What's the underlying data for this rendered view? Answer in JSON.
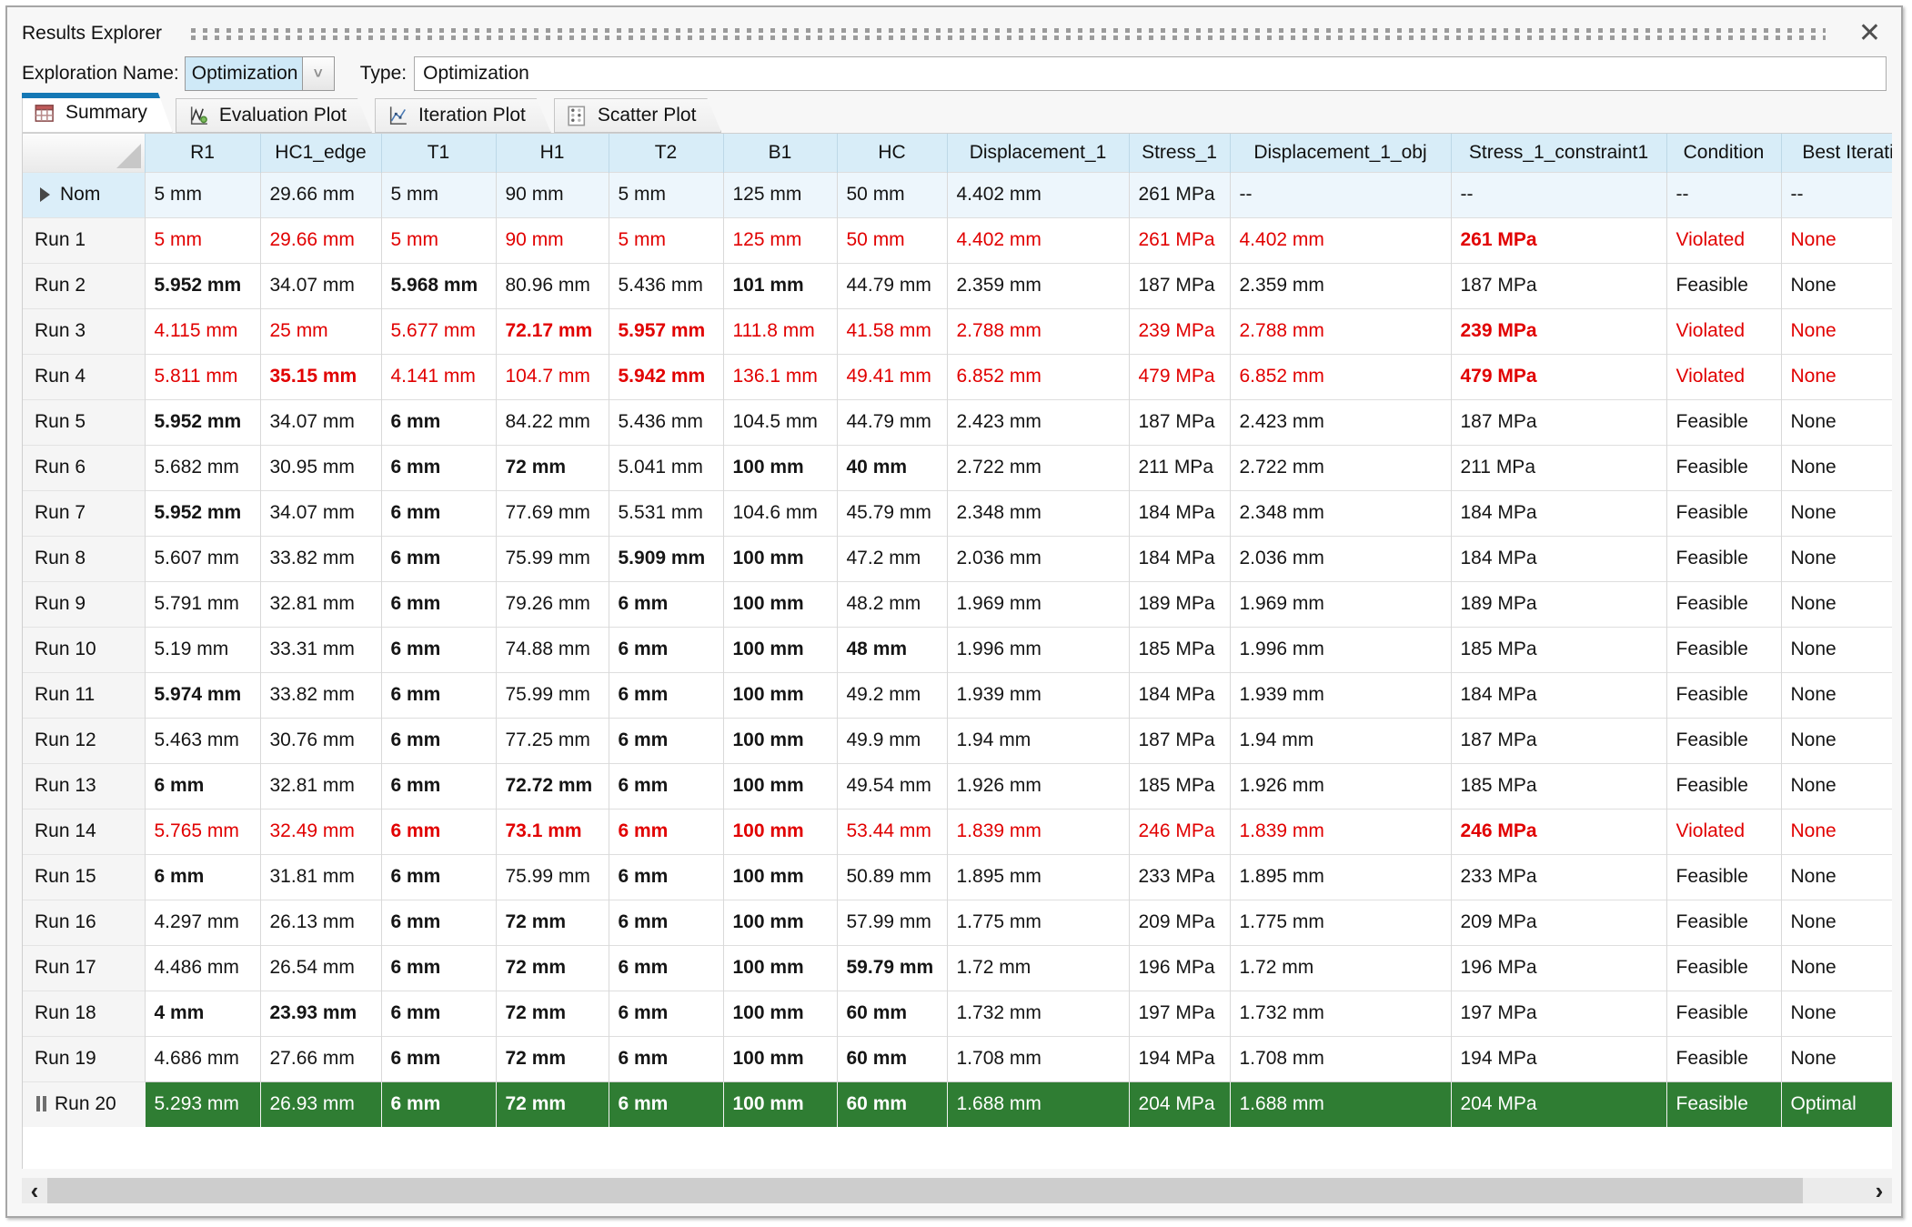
{
  "window": {
    "title": "Results Explorer"
  },
  "icons": {
    "close": "✕",
    "combo_chevron": "˅",
    "scroll_left": "‹",
    "scroll_right": "›"
  },
  "toolbar": {
    "exploration_label": "Exploration Name:",
    "exploration_value": "Optimization",
    "type_label": "Type:",
    "type_value": "Optimization"
  },
  "tabs": [
    {
      "label": "Summary",
      "icon": "summary-table-icon",
      "active": true
    },
    {
      "label": "Evaluation Plot",
      "icon": "evaluation-plot-icon",
      "active": false
    },
    {
      "label": "Iteration Plot",
      "icon": "iteration-plot-icon",
      "active": false
    },
    {
      "label": "Scatter Plot",
      "icon": "scatter-plot-icon",
      "active": false
    }
  ],
  "colors": {
    "active_tab_accent": "#1578b5",
    "header_bg": "#d8edf8",
    "nom_row_bg": "#edf6fc",
    "violated_text": "#e10000",
    "optimal_row_bg": "#2f7d33"
  },
  "table": {
    "columns": [
      "",
      "R1",
      "HC1_edge",
      "T1",
      "H1",
      "T2",
      "B1",
      "HC",
      "Displacement_1",
      "Stress_1",
      "Displacement_1_obj",
      "Stress_1_constraint1",
      "Condition",
      "Best Iteration"
    ],
    "rows": [
      {
        "label": "Nom",
        "icon": "play-icon",
        "state": "nom",
        "cells": [
          "5 mm",
          "29.66 mm",
          "5 mm",
          "90 mm",
          "5 mm",
          "125 mm",
          "50 mm",
          "4.402 mm",
          "261 MPa",
          "--",
          "--",
          "--",
          "--"
        ],
        "bold": []
      },
      {
        "label": "Run 1",
        "icon": null,
        "state": "violated",
        "cells": [
          "5 mm",
          "29.66 mm",
          "5 mm",
          "90 mm",
          "5 mm",
          "125 mm",
          "50 mm",
          "4.402 mm",
          "261 MPa",
          "4.402 mm",
          "261 MPa",
          "Violated",
          "None"
        ],
        "bold": [
          10
        ]
      },
      {
        "label": "Run 2",
        "icon": null,
        "state": "feasible",
        "cells": [
          "5.952 mm",
          "34.07 mm",
          "5.968 mm",
          "80.96 mm",
          "5.436 mm",
          "101 mm",
          "44.79 mm",
          "2.359 mm",
          "187 MPa",
          "2.359 mm",
          "187 MPa",
          "Feasible",
          "None"
        ],
        "bold": [
          0,
          2,
          5
        ]
      },
      {
        "label": "Run 3",
        "icon": null,
        "state": "violated",
        "cells": [
          "4.115 mm",
          "25 mm",
          "5.677 mm",
          "72.17 mm",
          "5.957 mm",
          "111.8 mm",
          "41.58 mm",
          "2.788 mm",
          "239 MPa",
          "2.788 mm",
          "239 MPa",
          "Violated",
          "None"
        ],
        "bold": [
          3,
          4,
          10
        ]
      },
      {
        "label": "Run 4",
        "icon": null,
        "state": "violated",
        "cells": [
          "5.811 mm",
          "35.15 mm",
          "4.141 mm",
          "104.7 mm",
          "5.942 mm",
          "136.1 mm",
          "49.41 mm",
          "6.852 mm",
          "479 MPa",
          "6.852 mm",
          "479 MPa",
          "Violated",
          "None"
        ],
        "bold": [
          1,
          4,
          10
        ]
      },
      {
        "label": "Run 5",
        "icon": null,
        "state": "feasible",
        "cells": [
          "5.952 mm",
          "34.07 mm",
          "6 mm",
          "84.22 mm",
          "5.436 mm",
          "104.5 mm",
          "44.79 mm",
          "2.423 mm",
          "187 MPa",
          "2.423 mm",
          "187 MPa",
          "Feasible",
          "None"
        ],
        "bold": [
          0,
          2
        ]
      },
      {
        "label": "Run 6",
        "icon": null,
        "state": "feasible",
        "cells": [
          "5.682 mm",
          "30.95 mm",
          "6 mm",
          "72 mm",
          "5.041 mm",
          "100 mm",
          "40 mm",
          "2.722 mm",
          "211 MPa",
          "2.722 mm",
          "211 MPa",
          "Feasible",
          "None"
        ],
        "bold": [
          2,
          3,
          5,
          6
        ]
      },
      {
        "label": "Run 7",
        "icon": null,
        "state": "feasible",
        "cells": [
          "5.952 mm",
          "34.07 mm",
          "6 mm",
          "77.69 mm",
          "5.531 mm",
          "104.6 mm",
          "45.79 mm",
          "2.348 mm",
          "184 MPa",
          "2.348 mm",
          "184 MPa",
          "Feasible",
          "None"
        ],
        "bold": [
          0,
          2
        ]
      },
      {
        "label": "Run 8",
        "icon": null,
        "state": "feasible",
        "cells": [
          "5.607 mm",
          "33.82 mm",
          "6 mm",
          "75.99 mm",
          "5.909 mm",
          "100 mm",
          "47.2 mm",
          "2.036 mm",
          "184 MPa",
          "2.036 mm",
          "184 MPa",
          "Feasible",
          "None"
        ],
        "bold": [
          2,
          4,
          5
        ]
      },
      {
        "label": "Run 9",
        "icon": null,
        "state": "feasible",
        "cells": [
          "5.791 mm",
          "32.81 mm",
          "6 mm",
          "79.26 mm",
          "6 mm",
          "100 mm",
          "48.2 mm",
          "1.969 mm",
          "189 MPa",
          "1.969 mm",
          "189 MPa",
          "Feasible",
          "None"
        ],
        "bold": [
          2,
          4,
          5
        ]
      },
      {
        "label": "Run 10",
        "icon": null,
        "state": "feasible",
        "cells": [
          "5.19 mm",
          "33.31 mm",
          "6 mm",
          "74.88 mm",
          "6 mm",
          "100 mm",
          "48 mm",
          "1.996 mm",
          "185 MPa",
          "1.996 mm",
          "185 MPa",
          "Feasible",
          "None"
        ],
        "bold": [
          2,
          4,
          5,
          6
        ]
      },
      {
        "label": "Run 11",
        "icon": null,
        "state": "feasible",
        "cells": [
          "5.974 mm",
          "33.82 mm",
          "6 mm",
          "75.99 mm",
          "6 mm",
          "100 mm",
          "49.2 mm",
          "1.939 mm",
          "184 MPa",
          "1.939 mm",
          "184 MPa",
          "Feasible",
          "None"
        ],
        "bold": [
          0,
          2,
          4,
          5
        ]
      },
      {
        "label": "Run 12",
        "icon": null,
        "state": "feasible",
        "cells": [
          "5.463 mm",
          "30.76 mm",
          "6 mm",
          "77.25 mm",
          "6 mm",
          "100 mm",
          "49.9 mm",
          "1.94 mm",
          "187 MPa",
          "1.94 mm",
          "187 MPa",
          "Feasible",
          "None"
        ],
        "bold": [
          2,
          4,
          5
        ]
      },
      {
        "label": "Run 13",
        "icon": null,
        "state": "feasible",
        "cells": [
          "6 mm",
          "32.81 mm",
          "6 mm",
          "72.72 mm",
          "6 mm",
          "100 mm",
          "49.54 mm",
          "1.926 mm",
          "185 MPa",
          "1.926 mm",
          "185 MPa",
          "Feasible",
          "None"
        ],
        "bold": [
          0,
          2,
          3,
          4,
          5
        ]
      },
      {
        "label": "Run 14",
        "icon": null,
        "state": "violated",
        "cells": [
          "5.765 mm",
          "32.49 mm",
          "6 mm",
          "73.1 mm",
          "6 mm",
          "100 mm",
          "53.44 mm",
          "1.839 mm",
          "246 MPa",
          "1.839 mm",
          "246 MPa",
          "Violated",
          "None"
        ],
        "bold": [
          2,
          3,
          4,
          5,
          10
        ]
      },
      {
        "label": "Run 15",
        "icon": null,
        "state": "feasible",
        "cells": [
          "6 mm",
          "31.81 mm",
          "6 mm",
          "75.99 mm",
          "6 mm",
          "100 mm",
          "50.89 mm",
          "1.895 mm",
          "233 MPa",
          "1.895 mm",
          "233 MPa",
          "Feasible",
          "None"
        ],
        "bold": [
          0,
          2,
          4,
          5
        ]
      },
      {
        "label": "Run 16",
        "icon": null,
        "state": "feasible",
        "cells": [
          "4.297 mm",
          "26.13 mm",
          "6 mm",
          "72 mm",
          "6 mm",
          "100 mm",
          "57.99 mm",
          "1.775 mm",
          "209 MPa",
          "1.775 mm",
          "209 MPa",
          "Feasible",
          "None"
        ],
        "bold": [
          2,
          3,
          4,
          5
        ]
      },
      {
        "label": "Run 17",
        "icon": null,
        "state": "feasible",
        "cells": [
          "4.486 mm",
          "26.54 mm",
          "6 mm",
          "72 mm",
          "6 mm",
          "100 mm",
          "59.79 mm",
          "1.72 mm",
          "196 MPa",
          "1.72 mm",
          "196 MPa",
          "Feasible",
          "None"
        ],
        "bold": [
          2,
          3,
          4,
          5,
          6
        ]
      },
      {
        "label": "Run 18",
        "icon": null,
        "state": "feasible",
        "cells": [
          "4 mm",
          "23.93 mm",
          "6 mm",
          "72 mm",
          "6 mm",
          "100 mm",
          "60 mm",
          "1.732 mm",
          "197 MPa",
          "1.732 mm",
          "197 MPa",
          "Feasible",
          "None"
        ],
        "bold": [
          0,
          1,
          2,
          3,
          4,
          5,
          6
        ]
      },
      {
        "label": "Run 19",
        "icon": null,
        "state": "feasible",
        "cells": [
          "4.686 mm",
          "27.66 mm",
          "6 mm",
          "72 mm",
          "6 mm",
          "100 mm",
          "60 mm",
          "1.708 mm",
          "194 MPa",
          "1.708 mm",
          "194 MPa",
          "Feasible",
          "None"
        ],
        "bold": [
          2,
          3,
          4,
          5,
          6
        ]
      },
      {
        "label": "Run 20",
        "icon": "pause-icon",
        "state": "optimal",
        "cells": [
          "5.293 mm",
          "26.93 mm",
          "6 mm",
          "72 mm",
          "6 mm",
          "100 mm",
          "60 mm",
          "1.688 mm",
          "204 MPa",
          "1.688 mm",
          "204 MPa",
          "Feasible",
          "Optimal"
        ],
        "bold": [
          2,
          3,
          4,
          5,
          6
        ]
      }
    ]
  }
}
